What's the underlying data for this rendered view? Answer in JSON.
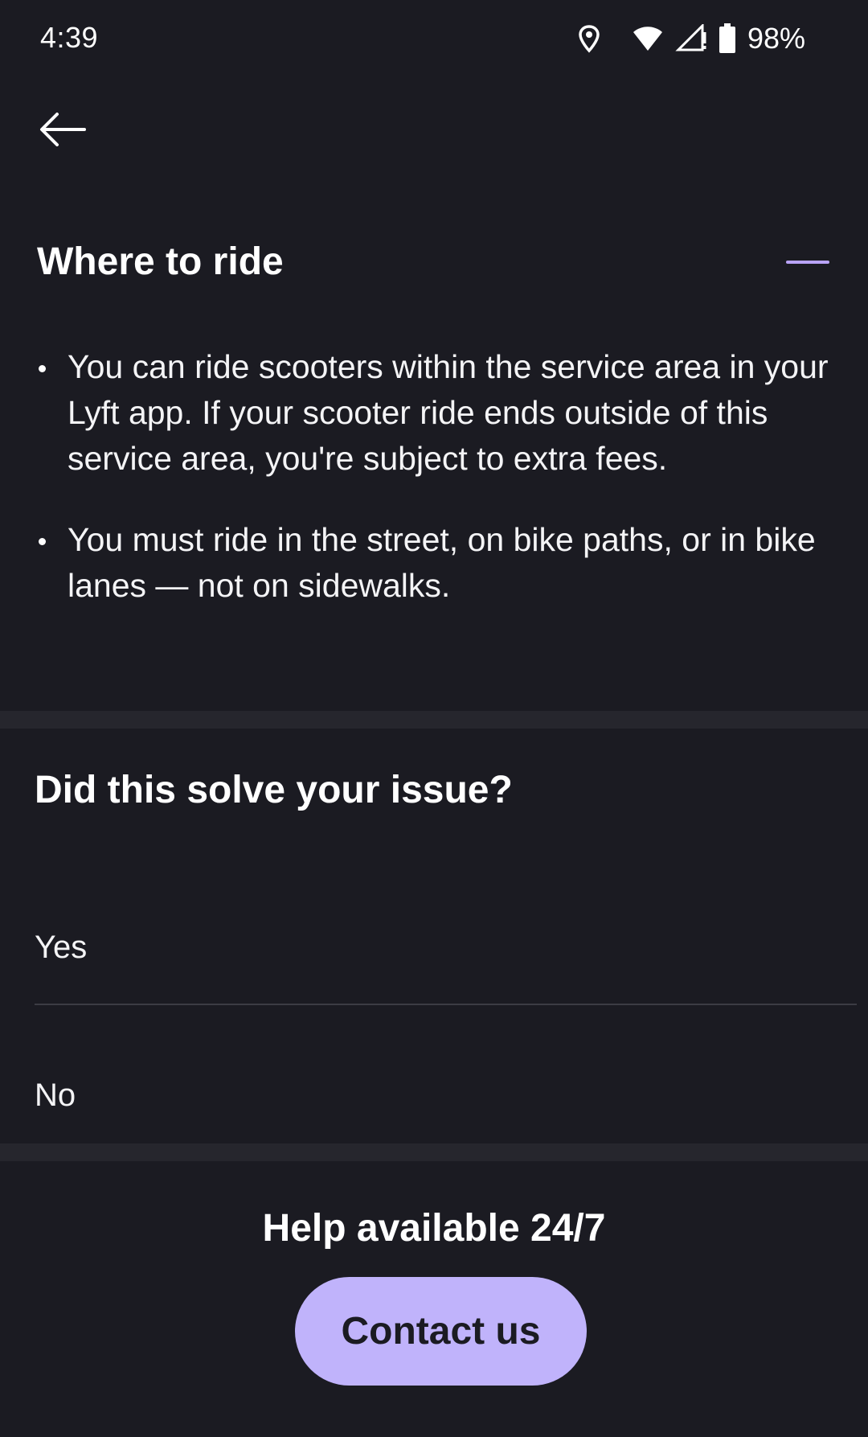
{
  "status_bar": {
    "time": "4:39",
    "battery": "98%",
    "icons": [
      "location-icon",
      "wifi-icon",
      "signal-icon",
      "battery-icon"
    ]
  },
  "header": {
    "back_icon": "arrow-left-icon"
  },
  "section": {
    "title": "Where to ride",
    "toggle_icon": "minus-icon",
    "bullets": [
      "You can ride scooters within the service area in your Lyft app. If your scooter ride ends outside of this service area, you're subject to extra fees.",
      "You must ride in the street, on bike paths, or in bike lanes — not on sidewalks."
    ]
  },
  "feedback": {
    "title": "Did this solve your issue?",
    "options": [
      "Yes",
      "No"
    ]
  },
  "help": {
    "title": "Help available 24/7",
    "button_label": "Contact us"
  },
  "colors": {
    "background": "#1b1b22",
    "divider": "#26262d",
    "accent": "#b9a3f7",
    "button": "#c0b3fb"
  }
}
